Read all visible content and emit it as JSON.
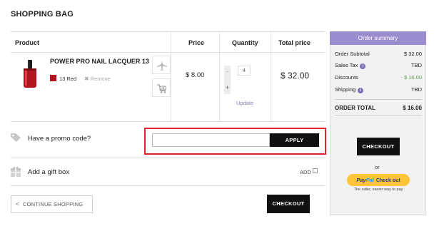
{
  "page": {
    "title": "SHOPPING BAG"
  },
  "table": {
    "headers": {
      "product": "Product",
      "price": "Price",
      "quantity": "Quantity",
      "total": "Total price"
    }
  },
  "item": {
    "name": "POWER PRO NAIL LACQUER 13",
    "color_name": "13 Red",
    "color_swatch": "#b3131f",
    "remove_label": "Remove",
    "price": "$ 8.00",
    "quantity": "4",
    "update_label": "Update",
    "total": "$ 32.00",
    "move_icon": "airplane-icon",
    "wishlist_icon": "cart-move-icon"
  },
  "promo": {
    "label": "Have a promo code?",
    "input_value": "",
    "apply_label": "APPLY",
    "icon": "tag-icon"
  },
  "gift": {
    "label": "Add a gift box",
    "add_label": "ADD",
    "checked": false,
    "icon": "gift-icon"
  },
  "actions": {
    "continue_label": "CONTINUE SHOPPING",
    "checkout_label": "CHECKOUT"
  },
  "summary": {
    "title": "Order summary",
    "rows": [
      {
        "label": "Order Subtotal",
        "value": "$ 32.00"
      },
      {
        "label": "Sales Tax",
        "value": "TBD"
      },
      {
        "label": "Discounts",
        "value": "- $ 16.00"
      },
      {
        "label": "Shipping",
        "value": "TBD"
      }
    ],
    "total_label": "ORDER TOTAL",
    "total_value": "$ 16.00",
    "checkout_label": "CHECKOUT",
    "or_label": "or",
    "paypal": {
      "brand_a": "Pay",
      "brand_b": "Pal",
      "label": "Check out",
      "tagline": "The safer, easier way to pay"
    }
  },
  "colors": {
    "accent_purple": "#9b8ccf",
    "discount_green": "#5aa05a",
    "highlight_red": "#e0262b",
    "button_black": "#111111",
    "paypal_yellow": "#ffc43a"
  }
}
